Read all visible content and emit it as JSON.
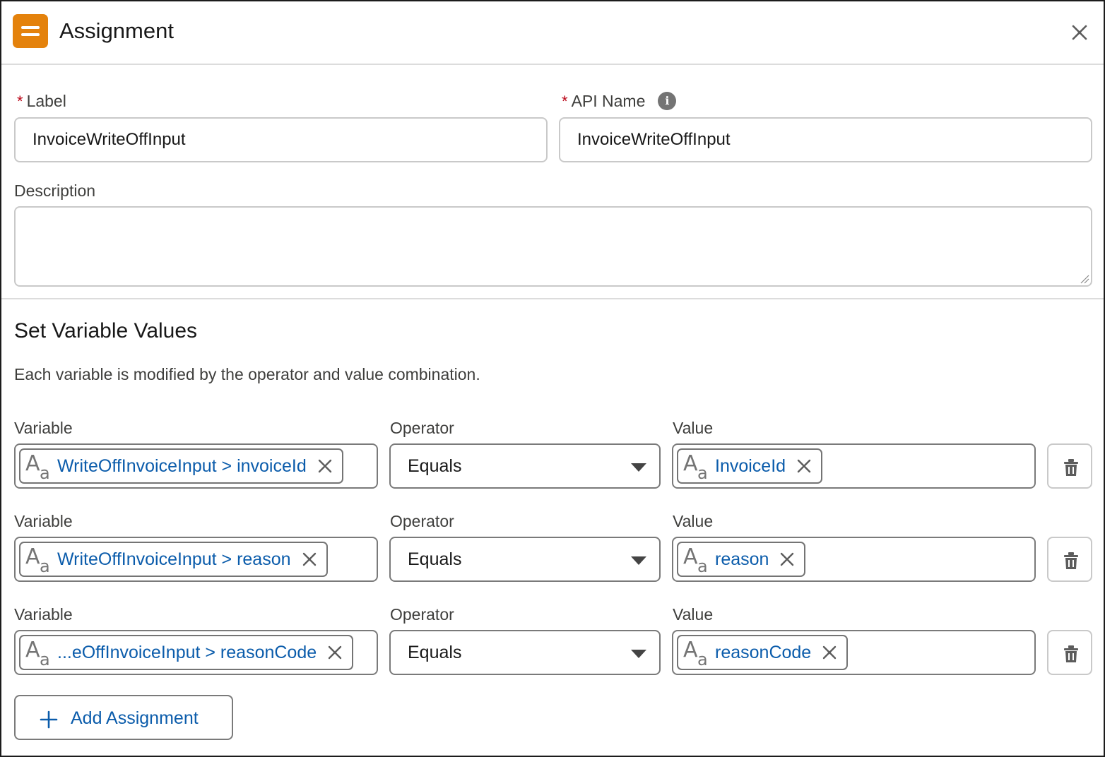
{
  "header": {
    "title": "Assignment",
    "icon": "assignment-icon",
    "accent_color": "#e4820c"
  },
  "form": {
    "label": {
      "label": "Label",
      "required_marker": "*",
      "value": "InvoiceWriteOffInput"
    },
    "api_name": {
      "label": "API Name",
      "required_marker": "*",
      "value": "InvoiceWriteOffInput"
    },
    "description": {
      "label": "Description",
      "value": ""
    }
  },
  "section": {
    "title": "Set Variable Values",
    "description": "Each variable is modified by the operator and value combination."
  },
  "columns": {
    "variable": "Variable",
    "operator": "Operator",
    "value": "Value"
  },
  "assignments": [
    {
      "variable": "WriteOffInvoiceInput > invoiceId",
      "operator": "Equals",
      "value": "InvoiceId"
    },
    {
      "variable": "WriteOffInvoiceInput > reason",
      "operator": "Equals",
      "value": "reason"
    },
    {
      "variable": "...eOffInvoiceInput > reasonCode",
      "operator": "Equals",
      "value": "reasonCode"
    }
  ],
  "add_button_label": "Add Assignment",
  "colors": {
    "link_blue": "#0b5cab",
    "required_red": "#ba0517"
  }
}
